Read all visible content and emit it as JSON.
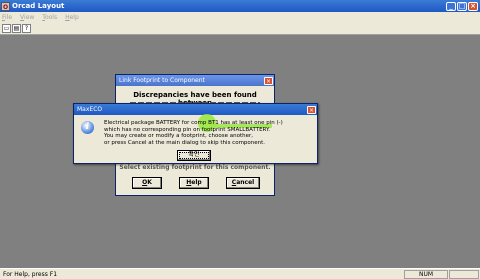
{
  "window": {
    "title": "Orcad Layout",
    "icon_letter": "O",
    "minimize_glyph": "_",
    "maximize_glyph": "□",
    "close_glyph": "×"
  },
  "menu": {
    "items": [
      {
        "label": "File"
      },
      {
        "label": "View"
      },
      {
        "label": "Tools"
      },
      {
        "label": "Help"
      }
    ]
  },
  "toolbar": {
    "new_glyph": "▭",
    "open_glyph": "▤",
    "help_glyph": "?"
  },
  "link_dialog": {
    "title": "Link Footprint to Component",
    "heading": "Discrepancies have been found between",
    "partial_text": "Select existing footprint for this component.",
    "ok_label": "OK",
    "help_label": "Help",
    "cancel_label": "Cancel"
  },
  "maxeco_dialog": {
    "title": "MaxECO",
    "icon_glyph": "i",
    "message_lines": [
      "Electrical package BATTERY for comp BT1 has at least one pin (-)",
      "which has no corresponding pin on footprint SMALLBATTERY.",
      "You may create or modify a footprint, choose another,",
      "or press Cancel at the main dialog to skip this component."
    ],
    "ok_label": "확인",
    "highlight_color": "#96e63c"
  },
  "status": {
    "text": "For Help, press F1",
    "num_indicator": "NUM"
  }
}
